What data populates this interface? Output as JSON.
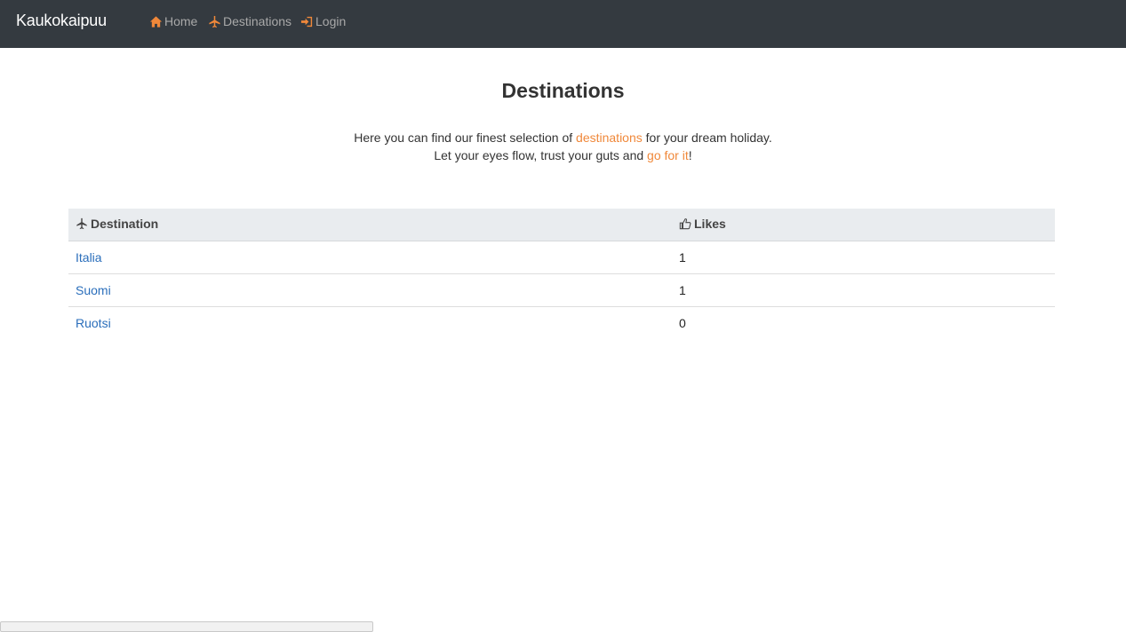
{
  "navbar": {
    "brand": "Kaukokaipuu",
    "links": [
      {
        "label": "Home",
        "icon": "home-icon"
      },
      {
        "label": "Destinations",
        "icon": "plane-icon"
      },
      {
        "label": "Login",
        "icon": "login-icon"
      }
    ],
    "accent_color": "#f0883a",
    "background_color": "#343a40"
  },
  "main": {
    "title": "Destinations",
    "intro": {
      "line1_before": "Here you can find our finest selection of ",
      "line1_link": "destinations",
      "line1_after": " for your dream holiday.",
      "line2_before": "Let your eyes flow, trust your guts and ",
      "line2_link": "go for it",
      "line2_after": "!"
    },
    "table": {
      "headers": [
        {
          "label": "Destination",
          "icon": "plane-icon"
        },
        {
          "label": "Likes",
          "icon": "thumbs-up-icon"
        }
      ],
      "rows": [
        {
          "destination": "Italia",
          "likes": "1"
        },
        {
          "destination": "Suomi",
          "likes": "1"
        },
        {
          "destination": "Ruotsi",
          "likes": "0"
        }
      ]
    }
  }
}
